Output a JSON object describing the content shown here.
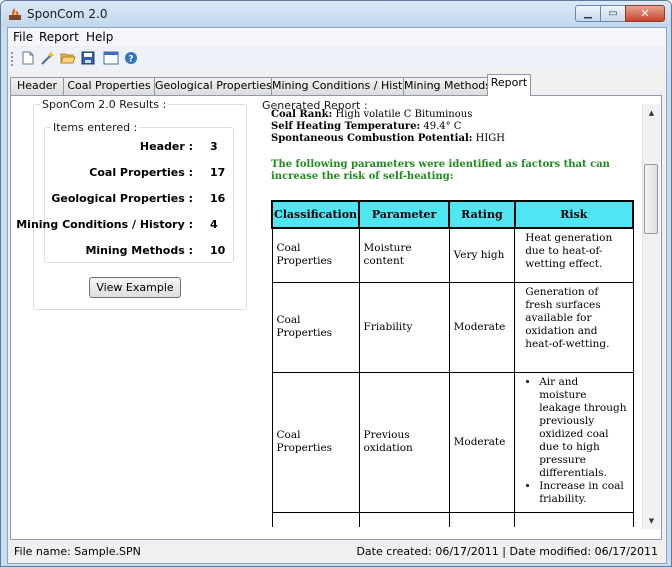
{
  "window": {
    "title": "SponCom 2.0"
  },
  "menu": [
    "File",
    "Report",
    "Help"
  ],
  "toolbar": {
    "icons": [
      "new-file-icon",
      "open-wizard-icon",
      "open-folder-icon",
      "save-icon",
      "window-icon",
      "help-icon"
    ]
  },
  "tabs": [
    {
      "label": "Header"
    },
    {
      "label": "Coal Properties"
    },
    {
      "label": "Geological Properties"
    },
    {
      "label": "Mining Conditions / History"
    },
    {
      "label": "Mining Methods"
    },
    {
      "label": "Report",
      "active": true
    }
  ],
  "results": {
    "title": "SponCom 2.0 Results :",
    "items_title": "Items entered :",
    "items": [
      {
        "label": "Header :",
        "value": "3"
      },
      {
        "label": "Coal Properties :",
        "value": "17"
      },
      {
        "label": "Geological Properties :",
        "value": "16"
      },
      {
        "label": "Mining Conditions / History :",
        "value": "4"
      },
      {
        "label": "Mining Methods :",
        "value": "10"
      }
    ],
    "view_example": "View Example"
  },
  "report": {
    "title": "Generated Report :",
    "coal_rank_label": "Coal Rank:",
    "coal_rank": "High volatile C Bituminous",
    "self_heating_label": "Self Heating Temperature:",
    "self_heating": "49.4° C",
    "spontaneous_label": "Spontaneous Combustion Potential:",
    "spontaneous": "HIGH",
    "note": "The following parameters were identified as factors that can increase the risk of self-heating:",
    "headers": [
      "Classification",
      "Parameter",
      "Rating",
      "Risk"
    ],
    "rows": [
      {
        "classification": "Coal Properties",
        "parameter": "Moisture content",
        "rating": "Very high",
        "risk": "Heat generation due to heat-of-wetting effect."
      },
      {
        "classification": "Coal Properties",
        "parameter": "Friability",
        "rating": "Moderate",
        "risk": "Generation of fresh surfaces available for oxidation and heat-of-wetting."
      },
      {
        "classification": "Coal Properties",
        "parameter": "Previous oxidation",
        "rating": "Moderate",
        "risk_list": [
          "Air and moisture leakage through previously oxidized coal due to high pressure differentials.",
          "Increase in coal friability."
        ]
      }
    ]
  },
  "status": {
    "file": "File name: Sample.SPN",
    "dates": "Date created: 06/17/2011 | Date modified: 06/17/2011"
  }
}
